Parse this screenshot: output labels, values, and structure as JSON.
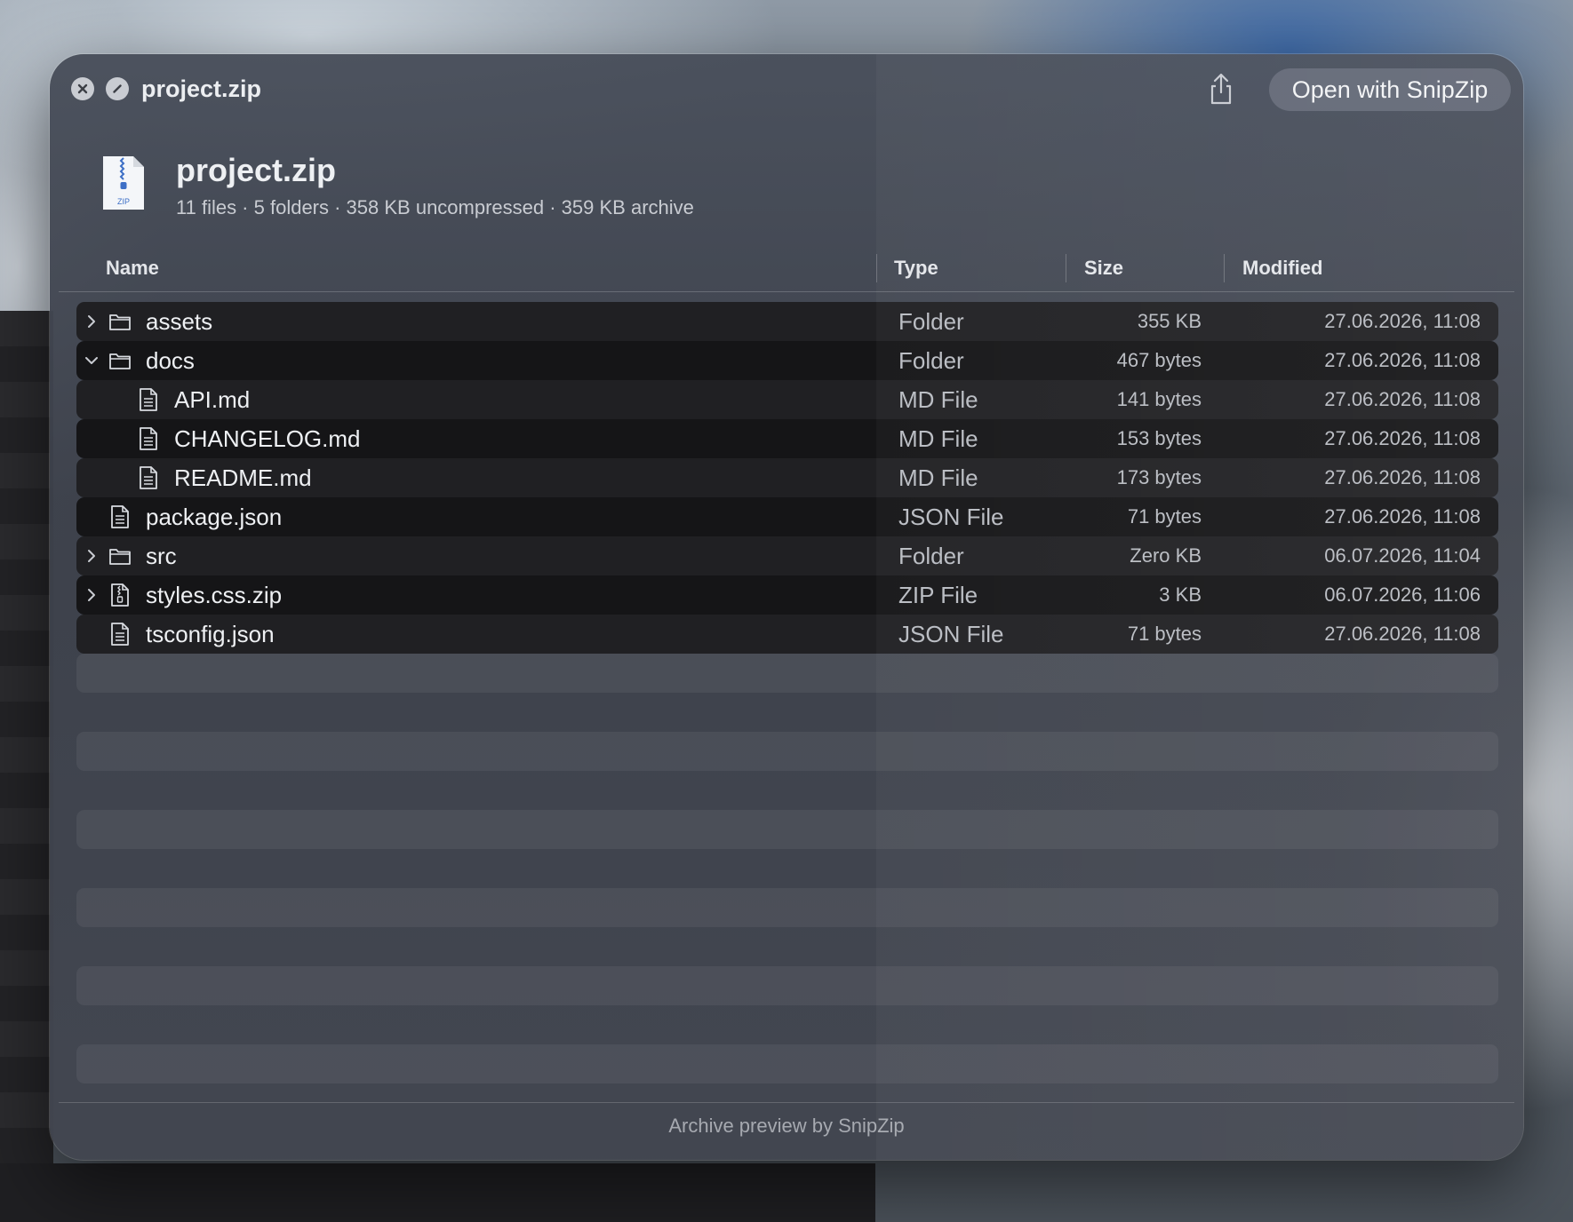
{
  "window": {
    "title": "project.zip",
    "open_button": "Open with SnipZip"
  },
  "archive": {
    "name": "project.zip",
    "icon_label": "ZIP",
    "summary": "11 files · 5 folders · 358 KB uncompressed · 359 KB archive"
  },
  "columns": {
    "name": "Name",
    "type": "Type",
    "size": "Size",
    "modified": "Modified"
  },
  "rows": [
    {
      "name": "assets",
      "type": "Folder",
      "size": "355 KB",
      "modified": "27.06.2026, 11:08",
      "icon": "folder-icon",
      "level": 0,
      "chevron": "right"
    },
    {
      "name": "docs",
      "type": "Folder",
      "size": "467 bytes",
      "modified": "27.06.2026, 11:08",
      "icon": "folder-icon",
      "level": 0,
      "chevron": "down"
    },
    {
      "name": "API.md",
      "type": "MD File",
      "size": "141 bytes",
      "modified": "27.06.2026, 11:08",
      "icon": "document-icon",
      "level": 1,
      "chevron": "none"
    },
    {
      "name": "CHANGELOG.md",
      "type": "MD File",
      "size": "153 bytes",
      "modified": "27.06.2026, 11:08",
      "icon": "document-icon",
      "level": 1,
      "chevron": "none"
    },
    {
      "name": "README.md",
      "type": "MD File",
      "size": "173 bytes",
      "modified": "27.06.2026, 11:08",
      "icon": "document-icon",
      "level": 1,
      "chevron": "none"
    },
    {
      "name": "package.json",
      "type": "JSON File",
      "size": "71 bytes",
      "modified": "27.06.2026, 11:08",
      "icon": "document-icon",
      "level": 0,
      "chevron": "none"
    },
    {
      "name": "src",
      "type": "Folder",
      "size": "Zero KB",
      "modified": "06.07.2026, 11:04",
      "icon": "folder-icon",
      "level": 0,
      "chevron": "right"
    },
    {
      "name": "styles.css.zip",
      "type": "ZIP File",
      "size": "3 KB",
      "modified": "06.07.2026, 11:06",
      "icon": "zip-file-icon",
      "level": 0,
      "chevron": "right"
    },
    {
      "name": "tsconfig.json",
      "type": "JSON File",
      "size": "71 bytes",
      "modified": "27.06.2026, 11:08",
      "icon": "document-icon",
      "level": 0,
      "chevron": "none"
    }
  ],
  "footer": "Archive preview by SnipZip"
}
